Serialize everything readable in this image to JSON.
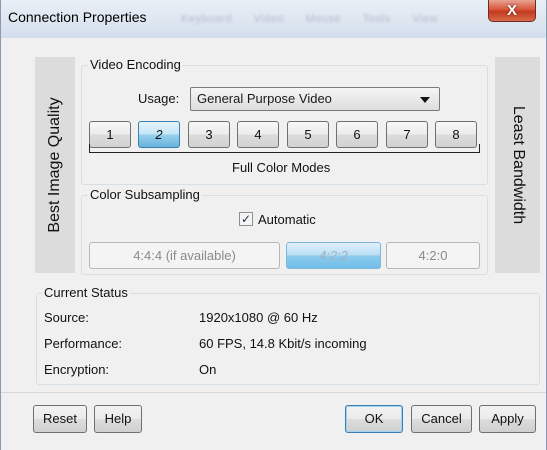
{
  "window": {
    "title": "Connection Properties",
    "ghost_menu": [
      "Keyboard",
      "Video",
      "Mouse",
      "Tools",
      "View"
    ],
    "close_glyph": "X"
  },
  "sides": {
    "left_label": "Best Image Quality",
    "right_label": "Least Bandwidth"
  },
  "video_encoding": {
    "legend": "Video Encoding",
    "usage_label": "Usage:",
    "usage_value": "General Purpose Video",
    "modes": [
      "1",
      "2",
      "3",
      "4",
      "5",
      "6",
      "7",
      "8"
    ],
    "selected_mode": "2",
    "modes_caption": "Full Color Modes"
  },
  "color_subsampling": {
    "legend": "Color Subsampling",
    "checkbox_label": "Automatic",
    "checkbox_checked": true,
    "check_glyph": "✓",
    "options": [
      "4:4:4 (if available)",
      "4:2:2",
      "4:2:0"
    ],
    "selected_option": "4:2:2"
  },
  "status": {
    "legend": "Current Status",
    "rows": [
      {
        "label": "Source:",
        "value": "1920x1080 @ 60 Hz"
      },
      {
        "label": "Performance:",
        "value": "60 FPS, 14.8 Kbit/s incoming"
      },
      {
        "label": "Encryption:",
        "value": "On"
      }
    ]
  },
  "buttons": {
    "reset": "Reset",
    "help": "Help",
    "ok": "OK",
    "cancel": "Cancel",
    "apply": "Apply"
  },
  "colors": {
    "accent_blue": "#68b3db",
    "close_red": "#c23a1e",
    "side_panel": "#dcdcdc"
  }
}
